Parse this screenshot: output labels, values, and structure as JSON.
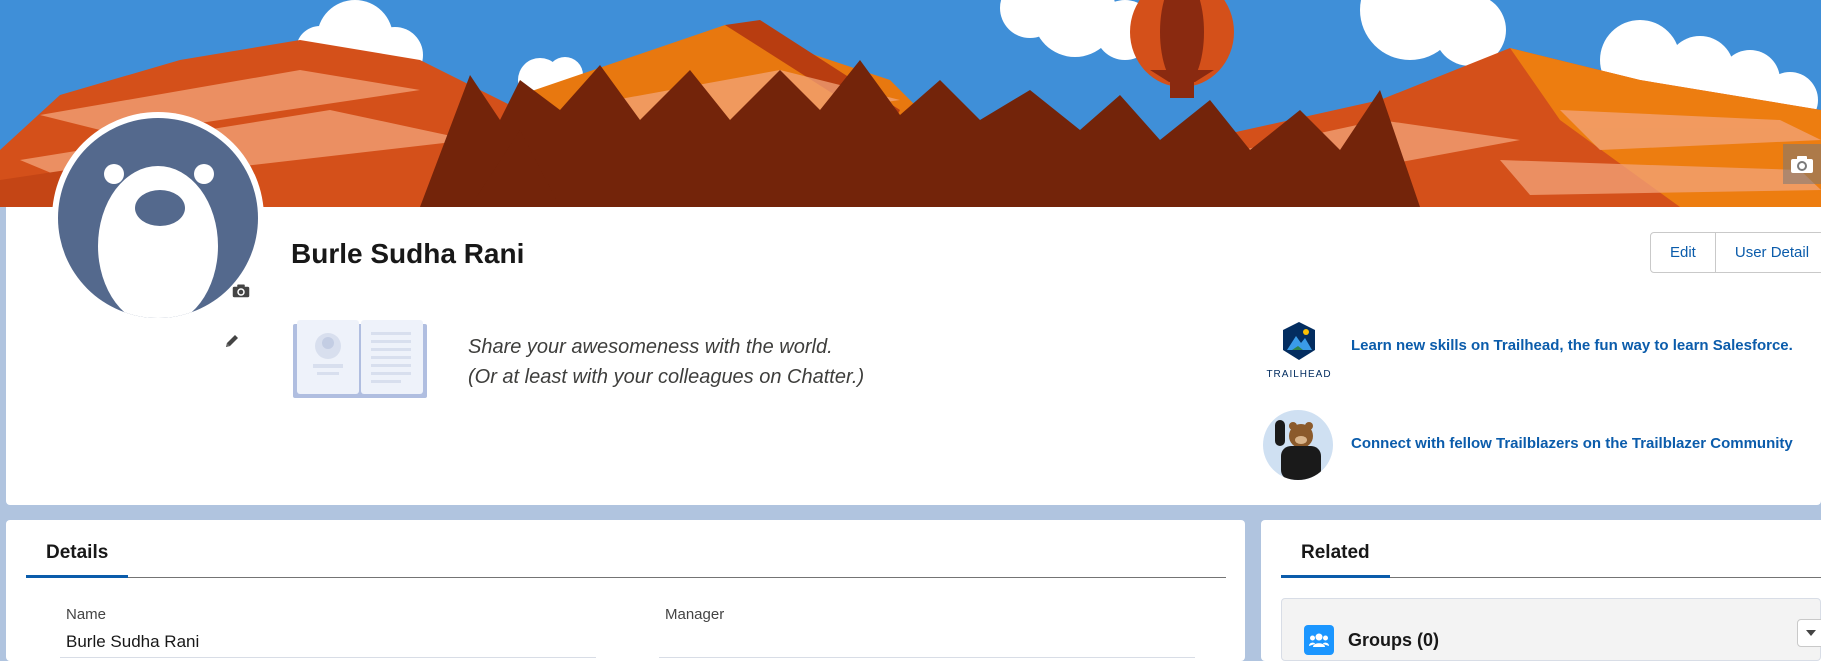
{
  "profile": {
    "name": "Burle Sudha Rani",
    "tagline_line1": "Share your awesomeness with the world.",
    "tagline_line2": "(Or at least with your colleagues on Chatter.)"
  },
  "actions": {
    "edit_label": "Edit",
    "user_detail_label": "User Detail"
  },
  "trailhead": {
    "logo_text": "TRAILHEAD",
    "learn_link": "Learn new skills on Trailhead, the fun way to learn Salesforce.",
    "community_link": "Connect with fellow Trailblazers on the Trailblazer Community"
  },
  "details": {
    "tab_label": "Details",
    "fields": {
      "name_label": "Name",
      "name_value": "Burle Sudha Rani",
      "manager_label": "Manager",
      "manager_value": ""
    }
  },
  "related": {
    "tab_label": "Related",
    "groups_title": "Groups (0)"
  },
  "icons": {
    "banner_camera": "camera-icon",
    "avatar_camera": "camera-icon",
    "avatar_edit": "pencil-icon",
    "groups": "groups-icon",
    "groups_menu": "chevron-down-icon"
  },
  "colors": {
    "accent": "#0b5cab",
    "page_bg": "#b0c4df",
    "avatar_bg": "#54698d"
  }
}
